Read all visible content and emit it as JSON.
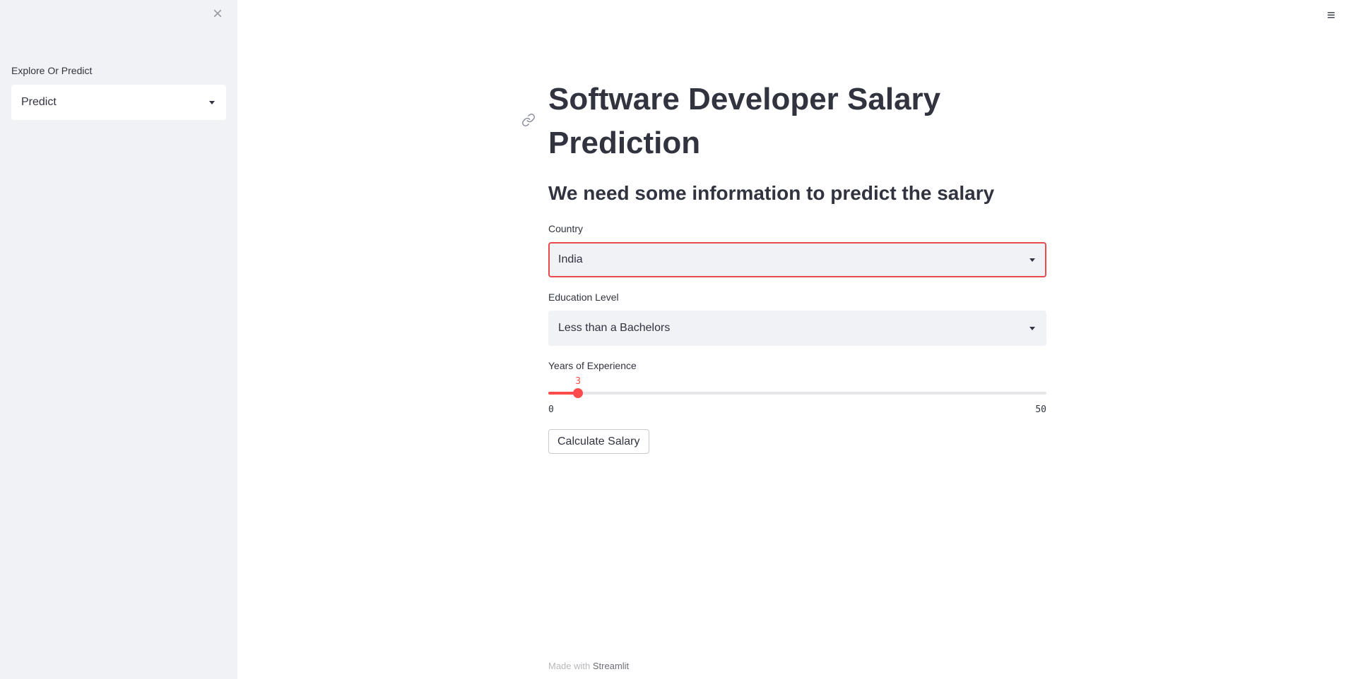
{
  "sidebar": {
    "close_icon": "close-icon",
    "select_label": "Explore Or Predict",
    "select_value": "Predict"
  },
  "header": {
    "menu_icon": "hamburger-menu-icon"
  },
  "main": {
    "title_line1": "Software Developer Salary",
    "title_line2": "Prediction",
    "subtitle": "We need some information to predict the salary",
    "country": {
      "label": "Country",
      "value": "India"
    },
    "education": {
      "label": "Education Level",
      "value": "Less than a Bachelors"
    },
    "experience": {
      "label": "Years of Experience",
      "value": 3,
      "min": 0,
      "max": 50,
      "value_label": "3",
      "min_label": "0",
      "max_label": "50"
    },
    "calculate_button": "Calculate Salary"
  },
  "footer": {
    "made_with": "Made with",
    "brand": "Streamlit"
  },
  "colors": {
    "accent": "#ff4b4b",
    "sidebar_bg": "#f0f2f6",
    "text": "#31333f"
  }
}
